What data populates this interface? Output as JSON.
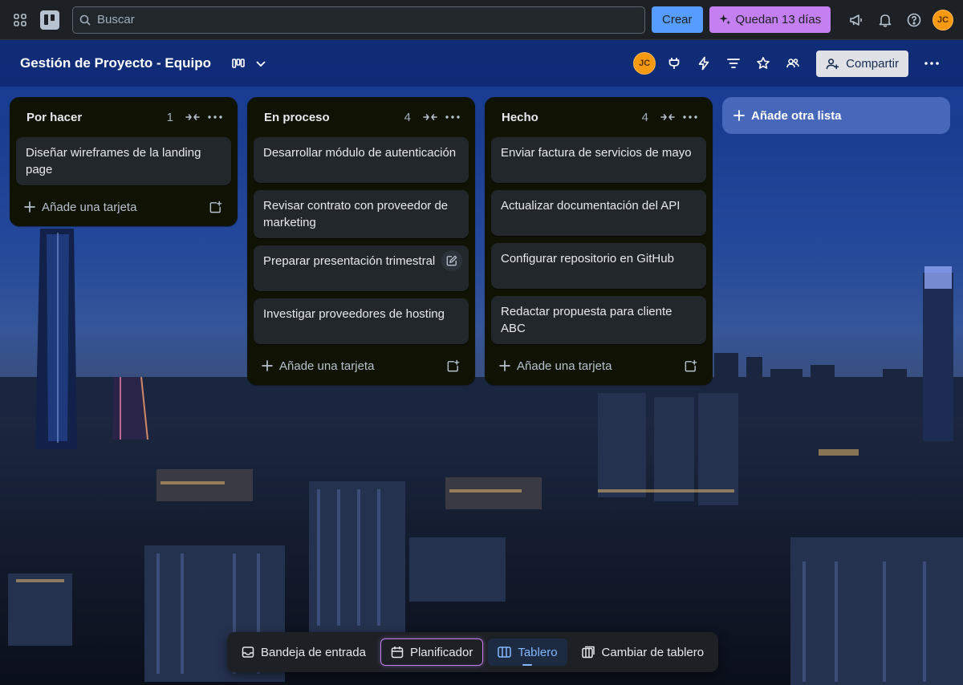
{
  "topbar": {
    "search_placeholder": "Buscar",
    "create_label": "Crear",
    "trial_label": "Quedan 13 días",
    "avatar_initials": "JC"
  },
  "board": {
    "title": "Gestión de Proyecto - Equipo",
    "member_initials": "JC",
    "share_label": "Compartir"
  },
  "lists": [
    {
      "title": "Por hacer",
      "count": "1",
      "cards": [
        "Diseñar wireframes de la landing page"
      ],
      "add_card_label": "Añade una tarjeta"
    },
    {
      "title": "En proceso",
      "count": "4",
      "cards": [
        "Desarrollar módulo de autenticación",
        "Revisar contrato con proveedor de marketing",
        "Preparar presentación trimestral",
        "Investigar proveedores de hosting"
      ],
      "add_card_label": "Añade una tarjeta"
    },
    {
      "title": "Hecho",
      "count": "4",
      "cards": [
        "Enviar factura de servicios de mayo",
        "Actualizar documentación del API",
        "Configurar repositorio en GitHub",
        "Redactar propuesta para cliente ABC"
      ],
      "add_card_label": "Añade una tarjeta"
    }
  ],
  "add_list_label": "Añade otra lista",
  "switcher": {
    "inbox_label": "Bandeja de entrada",
    "planner_label": "Planificador",
    "board_label": "Tablero",
    "switch_label": "Cambiar de tablero"
  },
  "colors": {
    "topbar_bg": "#1d2125",
    "list_bg": "#101204",
    "card_bg": "#22272b",
    "create_button": "#579dff",
    "trial_button": "#c47ff0",
    "avatar": "#f79a13",
    "active_tab": "#85b8ff"
  },
  "icons": {
    "apps": "grid-icon",
    "logo": "trello-logo-icon",
    "search": "search-icon",
    "trial": "sparkle-icon",
    "announcements": "megaphone-icon",
    "notifications": "bell-icon",
    "help": "help-icon",
    "board_view": "board-view-icon",
    "chevron": "chevron-down-icon",
    "power_ups": "plug-icon",
    "automation": "lightning-icon",
    "filter": "filter-icon",
    "star": "star-icon",
    "members": "members-icon",
    "share": "add-person-icon",
    "more": "more-horizontal-icon",
    "collapse": "collapse-list-icon",
    "template": "card-template-icon",
    "edit": "pencil-icon",
    "add": "plus-icon"
  }
}
